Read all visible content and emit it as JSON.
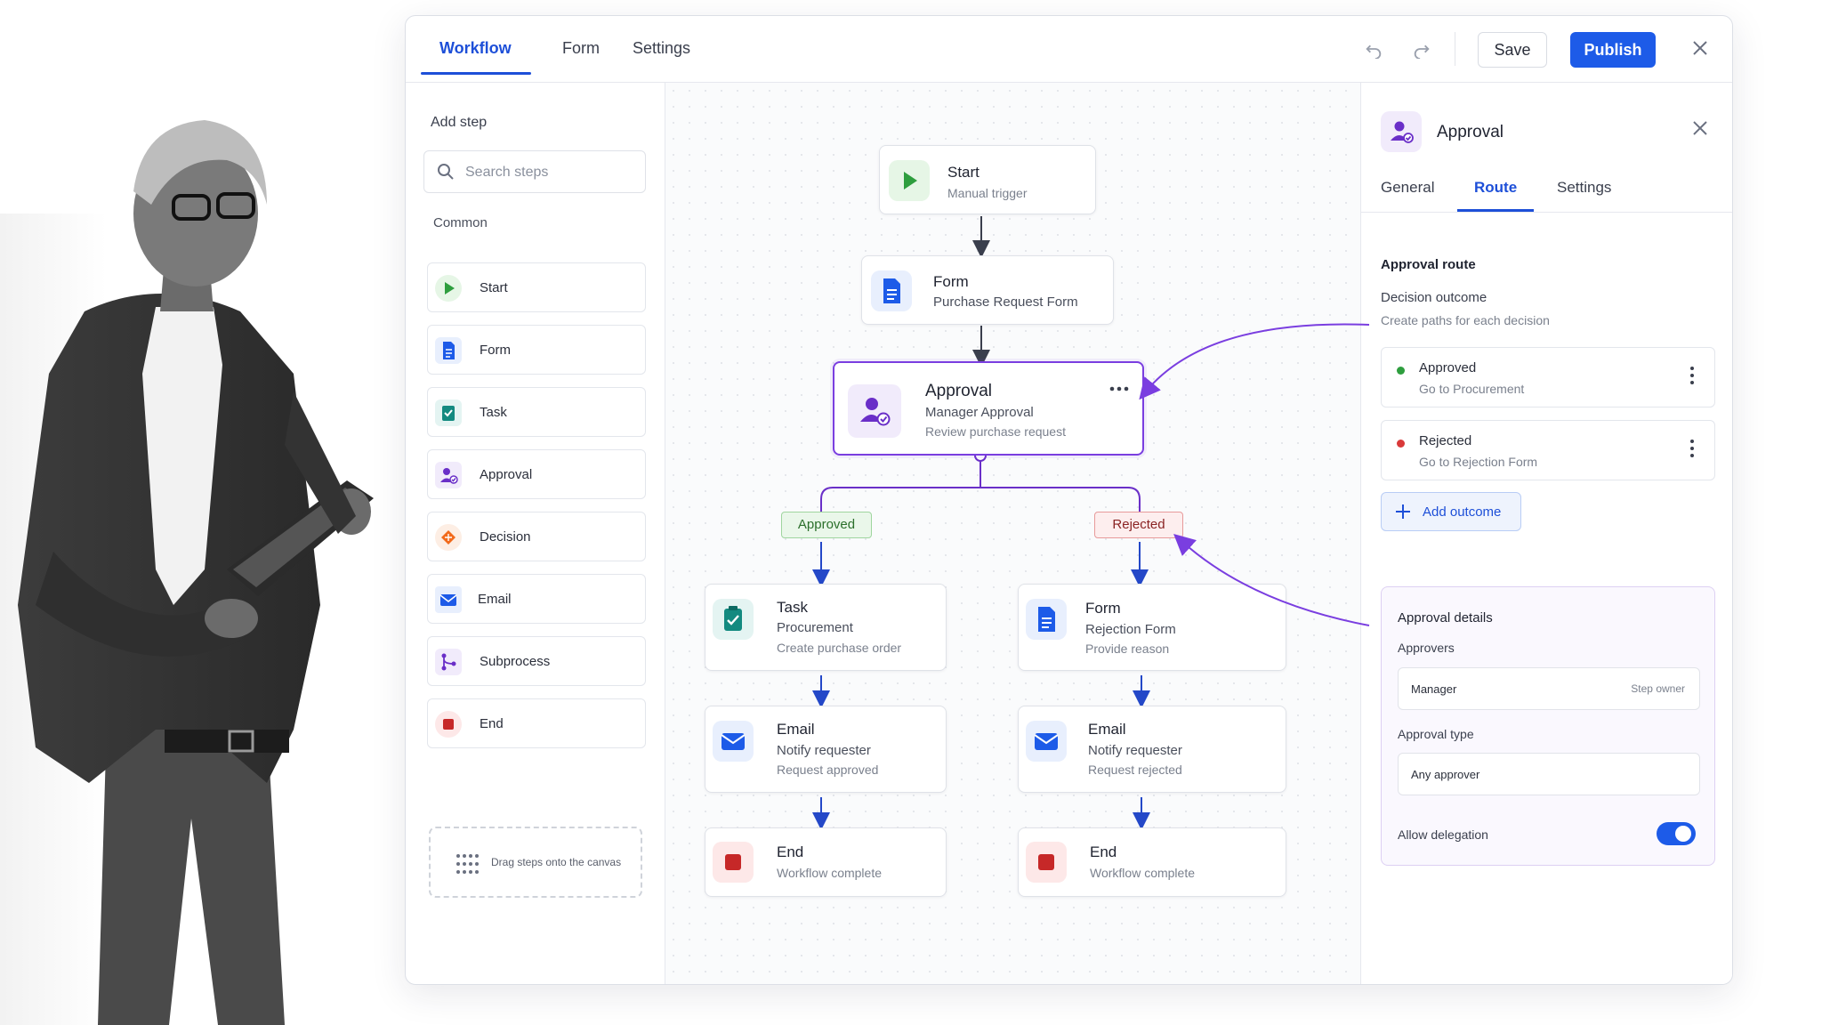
{
  "colors": {
    "primary": "#1d5be8",
    "accent_purple": "#7a3ee0",
    "success": "#2e9e3e",
    "danger": "#c62828",
    "orange": "#f26a1b"
  },
  "header": {
    "tabs": [
      "Workflow",
      "Form",
      "Settings"
    ],
    "active_tab": "Workflow",
    "save_label": "Save",
    "publish_label": "Publish"
  },
  "sidebar": {
    "heading": "Add step",
    "search_placeholder": "Search steps",
    "group_label": "Common",
    "items": [
      {
        "label": "Start",
        "icon": "play-icon"
      },
      {
        "label": "Form",
        "icon": "document-icon"
      },
      {
        "label": "Task",
        "icon": "checklist-icon"
      },
      {
        "label": "Approval",
        "icon": "user-check-icon"
      },
      {
        "label": "Decision",
        "icon": "diamond-icon"
      },
      {
        "label": "Email",
        "icon": "mail-icon"
      },
      {
        "label": "Subprocess",
        "icon": "branch-icon"
      },
      {
        "label": "End",
        "icon": "stop-icon"
      }
    ],
    "drop_hint": "Drag steps onto the canvas"
  },
  "canvas": {
    "start": {
      "title": "Start",
      "subtitle": "Manual trigger"
    },
    "form": {
      "title": "Form",
      "subtitle": "Purchase Request Form"
    },
    "approval": {
      "title": "Approval",
      "subtitle": "Manager Approval",
      "detail": "Review purchase request"
    },
    "branch_approved": "Approved",
    "branch_rejected": "Rejected",
    "left_task": {
      "title": "Task",
      "subtitle": "Procurement",
      "detail": "Create purchase order"
    },
    "right_form": {
      "title": "Form",
      "subtitle": "Rejection Form",
      "detail": "Provide reason"
    },
    "left_email": {
      "title": "Email",
      "subtitle": "Notify requester",
      "detail": "Request approved"
    },
    "right_email": {
      "title": "Email",
      "subtitle": "Notify requester",
      "detail": "Request rejected"
    },
    "left_end": {
      "title": "End",
      "subtitle": "Workflow complete"
    },
    "right_end": {
      "title": "End",
      "subtitle": "Workflow complete"
    }
  },
  "panel": {
    "title": "Approval",
    "tabs": [
      "General",
      "Route",
      "Settings"
    ],
    "active_tab": "Route",
    "section_title": "Approval route",
    "subsection_title": "Decision outcome",
    "hint": "Create paths for each decision",
    "outcomes": [
      {
        "name": "Approved",
        "target": "Go to Procurement",
        "status_color": "#2e9e3e"
      },
      {
        "name": "Rejected",
        "target": "Go to Rejection Form",
        "status_color": "#d93a3a"
      }
    ],
    "add_outcome_label": "Add outcome",
    "details": {
      "title": "Approval details",
      "approvers_label": "Approvers",
      "approver_value": "Manager",
      "approver_role": "Step owner",
      "approval_type_label": "Approval type",
      "approval_type_value": "Any approver",
      "delegation_label": "Allow delegation",
      "delegation_enabled": true
    }
  }
}
